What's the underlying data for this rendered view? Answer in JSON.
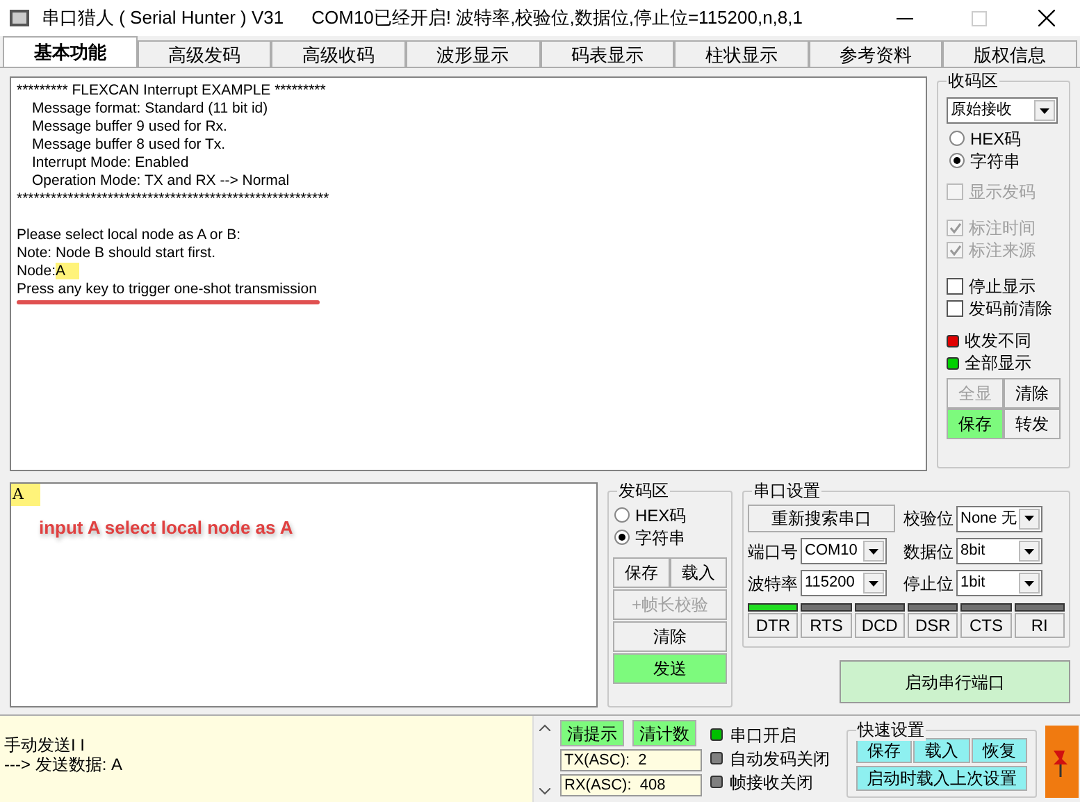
{
  "window": {
    "title": "串口猎人 ( Serial Hunter ) V31",
    "status": "COM10已经开启!  波特率,校验位,数据位,停止位=115200,n,8,1"
  },
  "tabs": [
    {
      "label": "基本功能",
      "selected": true
    },
    {
      "label": "高级发码",
      "selected": false
    },
    {
      "label": "高级收码",
      "selected": false
    },
    {
      "label": "波形显示",
      "selected": false
    },
    {
      "label": "码表显示",
      "selected": false
    },
    {
      "label": "柱状显示",
      "selected": false
    },
    {
      "label": "参考资料",
      "selected": false
    },
    {
      "label": "版权信息",
      "selected": false
    }
  ],
  "receive_log": {
    "banner": "********* FLEXCAN Interrupt EXAMPLE *********",
    "settings": [
      "Message format: Standard (11 bit id)",
      "Message buffer 9 used for Rx.",
      "Message buffer 8 used for Tx.",
      "Interrupt Mode: Enabled",
      "Operation Mode: TX and RX --> Normal"
    ],
    "rule": "*******************************************************",
    "prompts": [
      "Please select local node as A or B:",
      "Note: Node B should start first."
    ],
    "node_line": {
      "text": "Node:",
      "highlighted": "A"
    },
    "instruction": "Press any key to trigger one-shot transmission"
  },
  "receive_panel": {
    "title": "收码区",
    "mode": "原始接收",
    "radios": [
      {
        "label": "HEX码",
        "selected": false
      },
      {
        "label": "字符串",
        "selected": true
      }
    ],
    "checkbox_groups": [
      [
        {
          "label": "显示发码",
          "checked": false,
          "disabled": true
        }
      ],
      [
        {
          "label": "标注时间",
          "checked": true,
          "disabled": true
        },
        {
          "label": "标注来源",
          "checked": true,
          "disabled": true
        }
      ],
      [
        {
          "label": "停止显示",
          "checked": false,
          "disabled": false
        },
        {
          "label": "发码前清除",
          "checked": false,
          "disabled": false
        }
      ]
    ],
    "indicators": [
      {
        "label": "收发不同",
        "color": "#e00000"
      },
      {
        "label": "全部显示",
        "color": "#00d000"
      }
    ],
    "buttons": [
      {
        "label": "全显",
        "disabled": true,
        "highlighted": false
      },
      {
        "label": "清除",
        "disabled": false,
        "highlighted": false
      },
      {
        "label": "保存",
        "disabled": false,
        "highlighted": true
      },
      {
        "label": "转发",
        "disabled": false,
        "highlighted": false
      }
    ]
  },
  "send_box": {
    "value": "A",
    "annotation": "input A select local node as A"
  },
  "send_panel": {
    "title": "发码区",
    "radios": [
      {
        "label": "HEX码",
        "selected": false
      },
      {
        "label": "字符串",
        "selected": true
      }
    ],
    "pair_buttons": [
      {
        "label": "保存",
        "disabled": false,
        "highlighted": false
      },
      {
        "label": "载入",
        "disabled": false,
        "highlighted": false
      }
    ],
    "wide_buttons": [
      {
        "label": "+帧长校验",
        "disabled": true,
        "highlighted": false
      },
      {
        "label": "清除",
        "disabled": false,
        "highlighted": false
      },
      {
        "label": "发送",
        "disabled": false,
        "highlighted": true
      }
    ]
  },
  "serial": {
    "title": "串口设置",
    "rescan": "重新搜索串口",
    "fields": [
      {
        "label": "校验位",
        "value": "None 无"
      },
      {
        "label": "端口号",
        "value": "COM10"
      },
      {
        "label": "数据位",
        "value": "8bit"
      },
      {
        "label": "波特率",
        "value": "115200"
      },
      {
        "label": "停止位",
        "value": "1bit"
      }
    ],
    "signals": [
      {
        "label": "DTR",
        "on": true
      },
      {
        "label": "RTS",
        "on": false
      },
      {
        "label": "DCD",
        "on": false
      },
      {
        "label": "DSR",
        "on": false
      },
      {
        "label": "CTS",
        "on": false
      },
      {
        "label": "RI",
        "on": false
      }
    ]
  },
  "start_button": "启动串行端口",
  "status_bar": {
    "log": [
      "手动发送I I",
      "---> 发送数据: A"
    ],
    "buttons": [
      "清提示",
      "清计数"
    ],
    "counters": [
      "TX(ASC):  2",
      "RX(ASC):  408"
    ],
    "lights": [
      {
        "label": "串口开启",
        "color": "#00c000"
      },
      {
        "label": "自动发码关闭",
        "color": "#808080"
      },
      {
        "label": "帧接收关闭",
        "color": "#808080"
      }
    ],
    "quick": {
      "title": "快速设置",
      "buttons": [
        "保存",
        "载入",
        "恢复"
      ],
      "wide_button": "启动时载入上次设置"
    }
  }
}
